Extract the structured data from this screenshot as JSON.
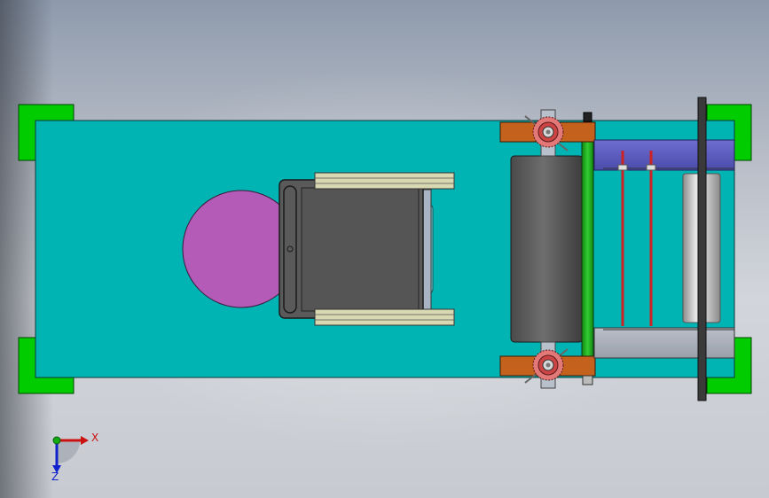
{
  "triad": {
    "x_label": "X",
    "z_label": "Z"
  },
  "colors": {
    "base_plate": "#00b4b4",
    "corner_brackets": "#00d000",
    "magenta_disc": "#b35bb6",
    "gray_block": "#585858",
    "green_rail": "#22bb22",
    "brown_arms": "#c4611c",
    "blue_bar": "#5c5cbc",
    "red_rods": "#cc2222",
    "axis_x": "#cc1111",
    "axis_z": "#1122cc",
    "axis_y": "#11aa11"
  }
}
